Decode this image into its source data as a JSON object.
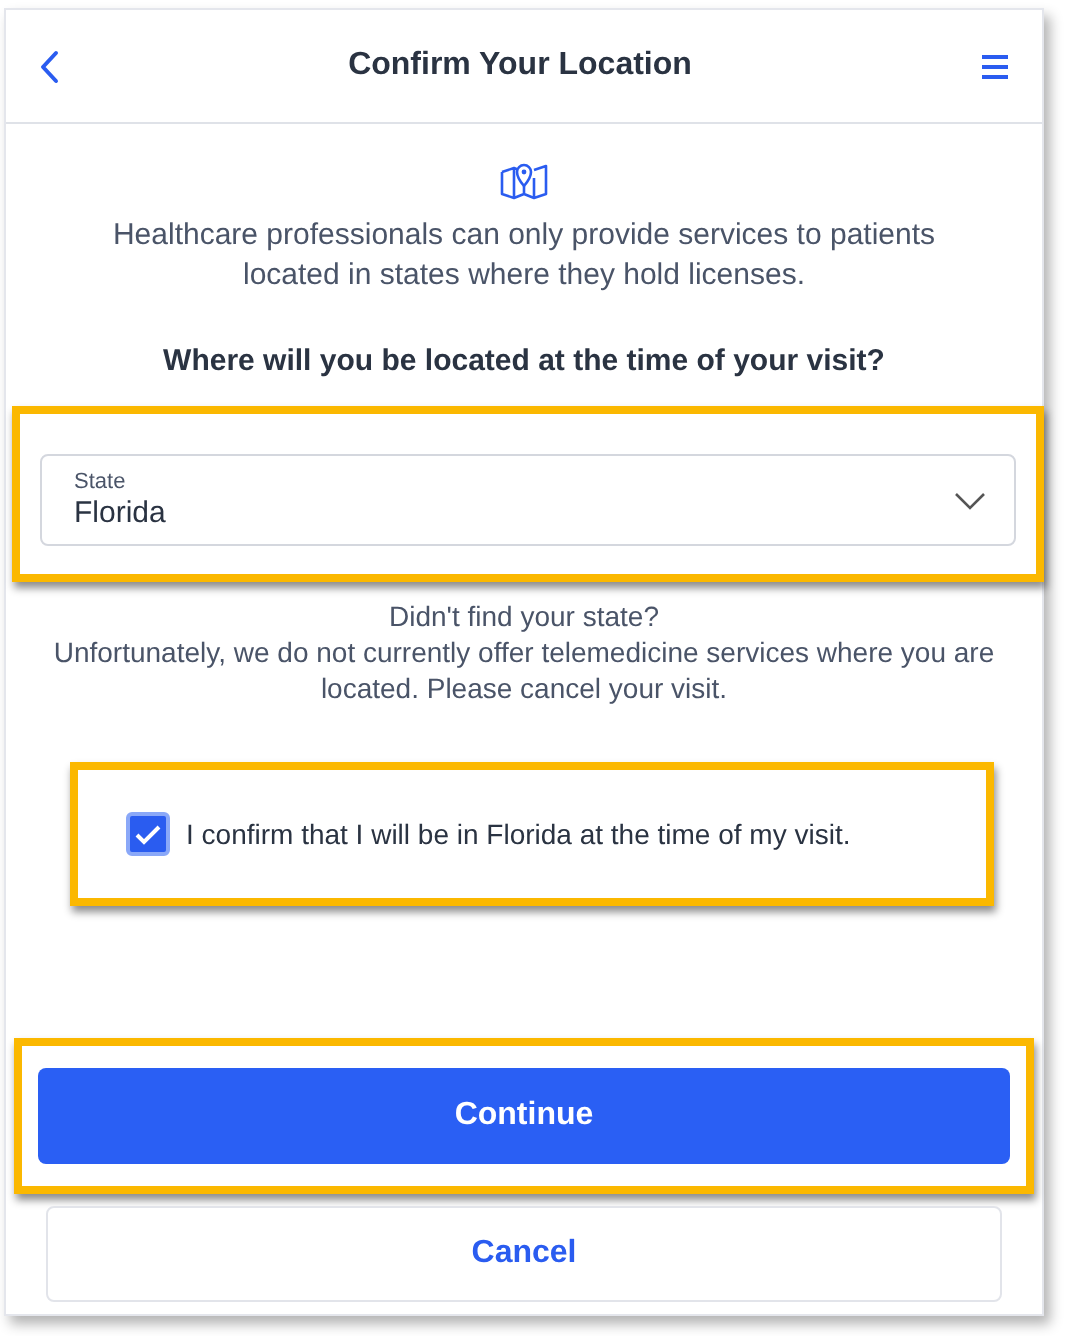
{
  "header": {
    "title": "Confirm Your Location"
  },
  "intro": "Healthcare professionals can only provide services to patients located in states where they hold licenses.",
  "question": "Where will you be located at the time of your visit?",
  "state_select": {
    "label": "State",
    "value": "Florida",
    "highlighted": true
  },
  "help": [
    "Didn't find your state?",
    "Unfortunately, we do not currently offer telemedicine services where you are located. Please cancel your visit."
  ],
  "confirm": {
    "label": "I confirm that I will be in Florida at the time of my visit.",
    "checked": true,
    "highlighted": true
  },
  "buttons": [
    {
      "label": "Continue",
      "kind": "primary",
      "highlighted": true
    },
    {
      "label": "Cancel",
      "kind": "secondary",
      "highlighted": false
    }
  ]
}
